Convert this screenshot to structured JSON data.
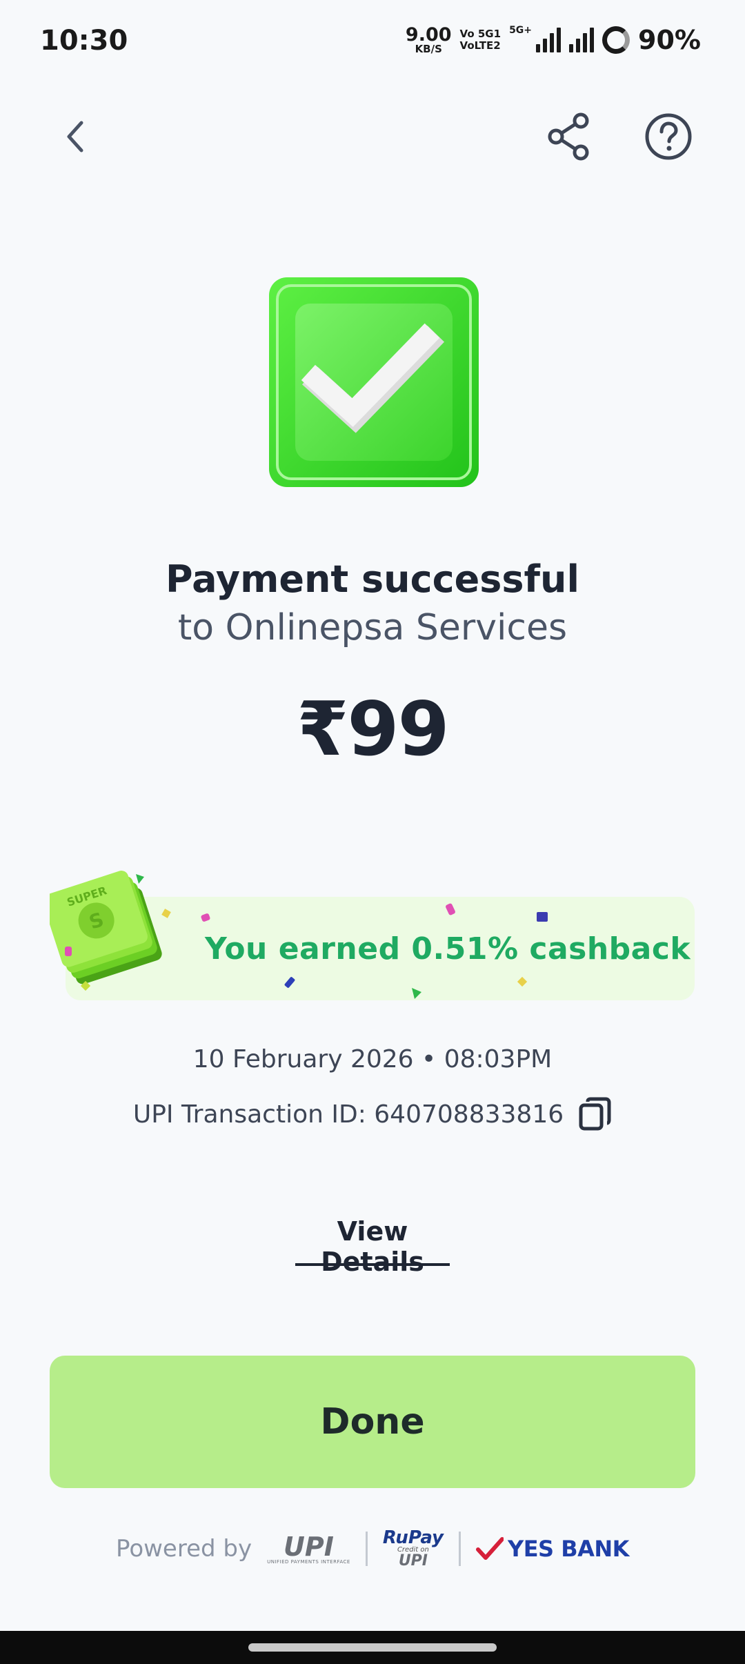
{
  "status_bar": {
    "time": "10:30",
    "net_speed_value": "9.00",
    "net_speed_unit": "KB/S",
    "volte_line1": "Vo 5G1",
    "volte_line2": "VoLTE2",
    "network_type": "5G+",
    "battery": "90%"
  },
  "nav": {
    "back_icon": "chevron-left-icon",
    "share_icon": "share-icon",
    "help_icon": "help-circle-icon"
  },
  "payment": {
    "title": "Payment successful",
    "subtitle": "to Onlinepsa Services",
    "amount": "₹99",
    "status_icon": "check-badge-icon"
  },
  "cashback": {
    "illustration_label": "SUPER",
    "text": "You earned 0.51% cashback"
  },
  "transaction": {
    "datetime": "10 February 2026 • 08:03PM",
    "upi_id_text": "UPI Transaction ID: 640708833816",
    "copy_icon": "copy-icon"
  },
  "actions": {
    "view_details": "View Details",
    "done": "Done"
  },
  "footer": {
    "powered_by": "Powered by",
    "upi_logo": "UPI",
    "upi_sub": "UNIFIED PAYMENTS INTERFACE",
    "rupay_top": "RuPay",
    "rupay_mid": "Credit on",
    "rupay_upi": "UPI",
    "bank": "YES BANK"
  },
  "colors": {
    "background": "#f7f9fb",
    "success_green": "#3ecb2a",
    "cashback_text": "#1faa62",
    "cashback_bg": "#edfbe3",
    "done_bg": "#b6ed8a",
    "text_dark": "#1e2533",
    "bank_blue": "#1f3fa8",
    "bank_red": "#d6203a"
  }
}
